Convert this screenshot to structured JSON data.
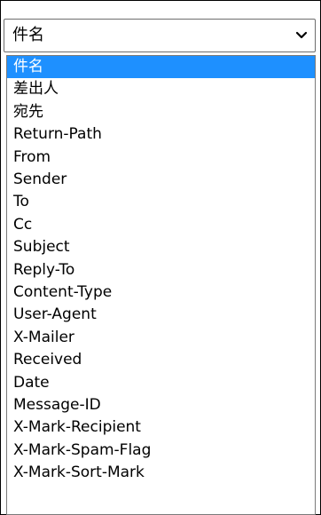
{
  "select": {
    "value": "件名"
  },
  "options": [
    "件名",
    "差出人",
    "宛先",
    "Return-Path",
    "From",
    "Sender",
    "To",
    "Cc",
    "Subject",
    "Reply-To",
    "Content-Type",
    "User-Agent",
    "X-Mailer",
    "Received",
    "Date",
    "Message-ID",
    "X-Mark-Recipient",
    "X-Mark-Spam-Flag",
    "X-Mark-Sort-Mark"
  ],
  "selected_index": 0,
  "icons": {
    "chevron": "chevron-down-icon"
  },
  "colors": {
    "selected_bg": "#1e90ff",
    "selected_text": "#ffffff"
  }
}
